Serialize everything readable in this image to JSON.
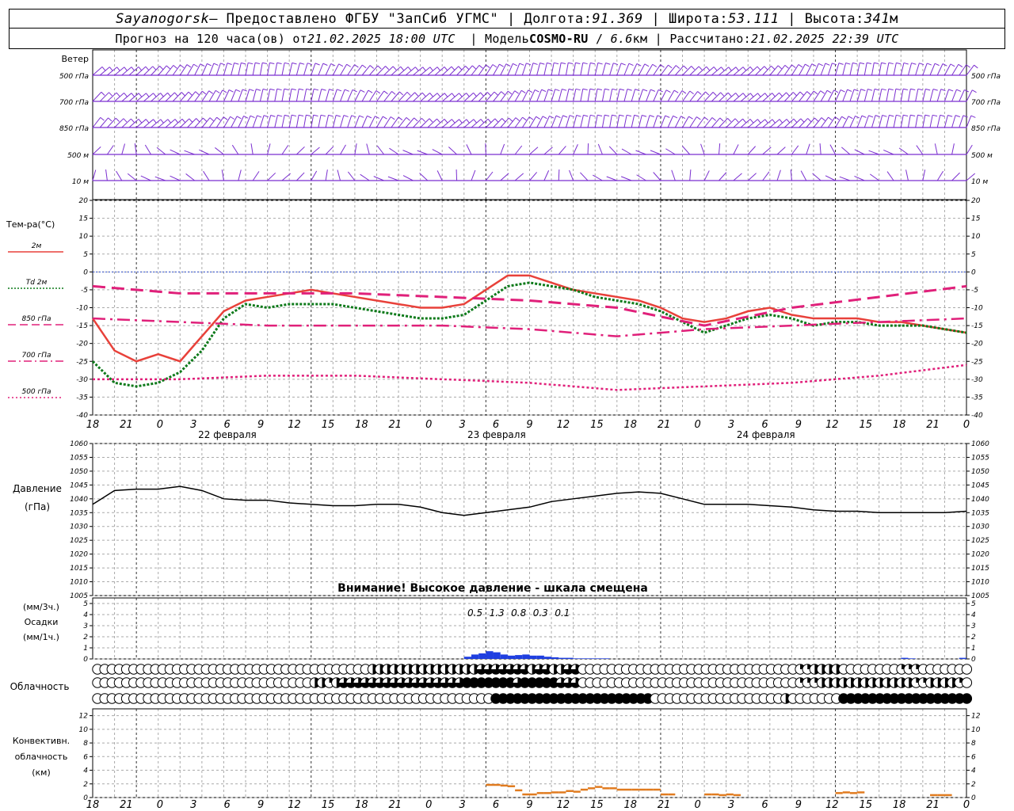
{
  "header": {
    "station": "Sayanogorsk",
    "provider": "— Предоставлено ФГБУ \"ЗапСиб УГМС\"",
    "lon_label": "Долгота:",
    "lon": "91.369",
    "lat_label": "Широта:",
    "lat": "53.111",
    "alt_label": "Высота:",
    "alt": "341",
    "alt_unit": "м",
    "forecast_label": "Прогноз на 120 часа(ов) от",
    "forecast_time": "21.02.2025 18:00 UTC",
    "model_label": "Модель",
    "model": "COSMO-RU",
    "model_res": "6.6",
    "model_res_unit": "км",
    "calc_label": "Рассчитано:",
    "calc_time": "21.02.2025 22:39 UTC"
  },
  "wind_panel": {
    "title": "Ветер",
    "levels": [
      "500 гПа",
      "700 гПа",
      "850 гПа",
      "500 м",
      "10 м"
    ],
    "color": "#7b2fd0"
  },
  "x_axis": {
    "ticks": [
      "18",
      "21",
      "0",
      "3",
      "6",
      "9",
      "12",
      "15",
      "18",
      "21",
      "0",
      "3",
      "6",
      "9",
      "12",
      "15",
      "18",
      "21",
      "0",
      "3",
      "6",
      "9",
      "12",
      "15",
      "18",
      "21",
      "0"
    ],
    "days": [
      "22 февраля",
      "23 февраля",
      "24 февраля"
    ]
  },
  "temp_panel": {
    "title": "Тем-ра(°C)",
    "y_ticks": [
      "20",
      "15",
      "10",
      "5",
      "0",
      "-5",
      "-10",
      "-15",
      "-20",
      "-25",
      "-30",
      "-35",
      "-40"
    ],
    "legend": [
      {
        "label": "2м",
        "color": "#e8413a",
        "style": "solid"
      },
      {
        "label": "Td  2м",
        "color": "#0d7a1a",
        "style": "dotted"
      },
      {
        "label": "850 гПа",
        "color": "#e0207a",
        "style": "dash"
      },
      {
        "label": "700 гПа",
        "color": "#e0207a",
        "style": "dashdot"
      },
      {
        "label": "500 гПа",
        "color": "#e0207a",
        "style": "dot"
      }
    ]
  },
  "pressure_panel": {
    "title": "Давление",
    "unit": "(гПа)",
    "y_ticks": [
      "1060",
      "1055",
      "1050",
      "1045",
      "1040",
      "1035",
      "1030",
      "1025",
      "1020",
      "1015",
      "1010",
      "1005"
    ],
    "warning": "Внимание! Высокое давление - шкала смещена"
  },
  "precip_panel": {
    "title1": "(мм/3ч.)",
    "title2": "Осадки",
    "title3": "(мм/1ч.)",
    "y_ticks": [
      "5",
      "4",
      "3",
      "2",
      "1",
      "0"
    ],
    "labels": [
      {
        "value": "0.5",
        "hour": 9
      },
      {
        "value": "1.3",
        "hour": 12
      },
      {
        "value": "0.8",
        "hour": 15
      },
      {
        "value": "0.3",
        "hour": 18
      },
      {
        "value": "0.1",
        "hour": 21
      }
    ]
  },
  "cloud_panel": {
    "title": "Облачность"
  },
  "conv_panel": {
    "title1": "Конвективн.",
    "title2": "облачность",
    "title3": "(км)",
    "y_ticks": [
      "12",
      "10",
      "8",
      "6",
      "4",
      "2",
      "0"
    ]
  },
  "chart_data": [
    {
      "type": "line",
      "title": "Тем-ра(°C)",
      "x_unit": "hours from 21.02.2025 18:00 UTC",
      "ylim": [
        -40,
        20
      ],
      "series": [
        {
          "name": "2м",
          "x": [
            0,
            3,
            6,
            9,
            12,
            15,
            18,
            21,
            24,
            27,
            30,
            33,
            36,
            39,
            42,
            45,
            48,
            51,
            54,
            57,
            60,
            63,
            66,
            69,
            72,
            75,
            78,
            81,
            84,
            87,
            90,
            93,
            96,
            99,
            102,
            105,
            108,
            111,
            114,
            117,
            120
          ],
          "values": [
            -13,
            -22,
            -25,
            -23,
            -25,
            -18,
            -11,
            -8,
            -7,
            -6,
            -5,
            -6,
            -7,
            -8,
            -9,
            -10,
            -10,
            -9,
            -5,
            -1,
            -1,
            -3,
            -5,
            -6,
            -7,
            -8,
            -10,
            -13,
            -14,
            -13,
            -11,
            -10,
            -12,
            -13,
            -13,
            -13,
            -14,
            -14,
            -15,
            -16,
            -17
          ],
          "color": "#e8413a"
        },
        {
          "name": "Td 2м",
          "x": [
            0,
            3,
            6,
            9,
            12,
            15,
            18,
            21,
            24,
            27,
            30,
            33,
            36,
            39,
            42,
            45,
            48,
            51,
            54,
            57,
            60,
            63,
            66,
            69,
            72,
            75,
            78,
            81,
            84,
            87,
            90,
            93,
            96,
            99,
            102,
            105,
            108,
            111,
            114,
            117,
            120
          ],
          "values": [
            -25,
            -31,
            -32,
            -31,
            -28,
            -22,
            -13,
            -9,
            -10,
            -9,
            -9,
            -9,
            -10,
            -11,
            -12,
            -13,
            -13,
            -12,
            -8,
            -4,
            -3,
            -4,
            -5,
            -7,
            -8,
            -9,
            -11,
            -14,
            -17,
            -15,
            -13,
            -12,
            -13,
            -15,
            -14,
            -14,
            -15,
            -15,
            -15,
            -16,
            -17
          ],
          "color": "#0d7a1a"
        },
        {
          "name": "850 гПа",
          "x": [
            0,
            12,
            24,
            36,
            48,
            60,
            72,
            84,
            96,
            108,
            120
          ],
          "values": [
            -4,
            -6,
            -6,
            -6,
            -7,
            -8,
            -10,
            -15,
            -10,
            -7,
            -4
          ],
          "color": "#e0207a"
        },
        {
          "name": "700 гПа",
          "x": [
            0,
            12,
            24,
            36,
            48,
            60,
            72,
            84,
            96,
            108,
            120
          ],
          "values": [
            -13,
            -14,
            -15,
            -15,
            -15,
            -16,
            -18,
            -16,
            -15,
            -14,
            -13
          ],
          "color": "#e0207a"
        },
        {
          "name": "500 гПа",
          "x": [
            0,
            12,
            24,
            36,
            48,
            60,
            72,
            84,
            96,
            108,
            120
          ],
          "values": [
            -30,
            -30,
            -29,
            -29,
            -30,
            -31,
            -33,
            -32,
            -31,
            -29,
            -26
          ],
          "color": "#e0207a"
        }
      ]
    },
    {
      "type": "line",
      "title": "Давление",
      "x_unit": "hours from 21.02.2025 18:00 UTC",
      "ylim": [
        1005,
        1060
      ],
      "series": [
        {
          "name": "",
          "x": [
            0,
            3,
            6,
            9,
            12,
            15,
            18,
            21,
            24,
            27,
            30,
            33,
            36,
            39,
            42,
            45,
            48,
            51,
            54,
            57,
            60,
            63,
            66,
            69,
            72,
            75,
            78,
            81,
            84,
            87,
            90,
            93,
            96,
            99,
            102,
            105,
            108,
            111,
            114,
            117,
            120
          ],
          "values": [
            1038,
            1043,
            1043.5,
            1043.5,
            1044.5,
            1043,
            1040,
            1039.5,
            1039.5,
            1038.5,
            1038,
            1037.5,
            1037.5,
            1038,
            1038,
            1037,
            1035,
            1034,
            1035,
            1036,
            1037,
            1039,
            1040,
            1041,
            1042,
            1042.5,
            1042,
            1040,
            1038,
            1038,
            1038,
            1037.5,
            1037,
            1036,
            1035.5,
            1035.5,
            1035,
            1035,
            1035,
            1035,
            1035.5
          ],
          "color": "#000000"
        }
      ]
    },
    {
      "type": "bar",
      "title": "Осадки",
      "x_unit": "hours from 21.02.2025 18:00 UTC",
      "ylim": [
        0,
        5
      ],
      "x": [
        51,
        52,
        53,
        54,
        55,
        56,
        57,
        58,
        59,
        60,
        61,
        62,
        63,
        64,
        65,
        66,
        67,
        68,
        69,
        70,
        111,
        112,
        119
      ],
      "values": [
        0.2,
        0.4,
        0.5,
        0.7,
        0.6,
        0.4,
        0.3,
        0.35,
        0.4,
        0.3,
        0.3,
        0.2,
        0.15,
        0.1,
        0.1,
        0.05,
        0.05,
        0.05,
        0.05,
        0.05,
        0.1,
        0.05,
        0.1
      ],
      "color": "#1f3fe0"
    },
    {
      "type": "table",
      "title": "Облачность",
      "rows": [
        {
          "name": "upper",
          "fractions": [
            0,
            0,
            0,
            0,
            0,
            0,
            0,
            0,
            0,
            0,
            0,
            0,
            0,
            0,
            0,
            0,
            0,
            0,
            0,
            0,
            0,
            0,
            0,
            0,
            0,
            0,
            0,
            0,
            0,
            0,
            0,
            0,
            0,
            0,
            0,
            0,
            0,
            0,
            0.5,
            0.5,
            0.5,
            0.5,
            0.5,
            0.5,
            0.5,
            0.5,
            0.5,
            0.5,
            0.5,
            0.5,
            0.5,
            0.5,
            0.5,
            0.75,
            0.75,
            0.75,
            0.75,
            0.75,
            0.75,
            0.75,
            0.5,
            0.75,
            0.75,
            0.5,
            0.5,
            0.75,
            0.75,
            0,
            0,
            0,
            0,
            0,
            0,
            0,
            0,
            0,
            0,
            0,
            0,
            0,
            0,
            0,
            0,
            0,
            0,
            0,
            0,
            0,
            0,
            0,
            0,
            0,
            0,
            0,
            0,
            0,
            0,
            0.25,
            0.25,
            0.5,
            0.5,
            0.5,
            0.5,
            0,
            0,
            0,
            0,
            0,
            0,
            0,
            0,
            0.25,
            0.25,
            0.25,
            0,
            0,
            0,
            0,
            0,
            0,
            0,
            0,
            0
          ]
        },
        {
          "name": "middle",
          "fractions": [
            0,
            0,
            0,
            0,
            0,
            0,
            0,
            0,
            0,
            0,
            0,
            0,
            0,
            0,
            0,
            0,
            0,
            0,
            0,
            0,
            0,
            0,
            0,
            0,
            0,
            0,
            0,
            0,
            0,
            0,
            0.5,
            0.5,
            0.25,
            0.5,
            0.75,
            0.75,
            0.75,
            0.75,
            0.75,
            0.75,
            0.75,
            0.75,
            0.75,
            0.75,
            0.75,
            0.75,
            0.75,
            0.75,
            0.75,
            0.75,
            0.75,
            1,
            1,
            1,
            1,
            1,
            1,
            1,
            0.75,
            1,
            1,
            1,
            1,
            1,
            0.75,
            0.75,
            0.75,
            0,
            0,
            0,
            0,
            0,
            0,
            0,
            0,
            0,
            0,
            0,
            0,
            0,
            0,
            0,
            0,
            0,
            0,
            0,
            0,
            0,
            0,
            0,
            0,
            0,
            0,
            0,
            0,
            0,
            0,
            0.25,
            0.25,
            0.25,
            0.5,
            0.5,
            0.5,
            0.5,
            0.5,
            0.5,
            0.5,
            0.5,
            0.5,
            0.5,
            0.5,
            0.5,
            0.5,
            0.25,
            0.25,
            0.5,
            0.5,
            0.5,
            0.5,
            0.25,
            0
          ]
        },
        {
          "name": "lower",
          "fractions": [
            0,
            0,
            0,
            0,
            0,
            0,
            0,
            0,
            0,
            0,
            0,
            0,
            0,
            0,
            0,
            0,
            0,
            0,
            0,
            0,
            0,
            0,
            0,
            0,
            0,
            0,
            0,
            0,
            0,
            0,
            0,
            0,
            0,
            0,
            0,
            0,
            0,
            0,
            0,
            0,
            0,
            0,
            0,
            0,
            0,
            0,
            0,
            0,
            0,
            0,
            0,
            0,
            0,
            0,
            0,
            1,
            1,
            1,
            1,
            1,
            1,
            1,
            1,
            1,
            1,
            1,
            1,
            1,
            1,
            1,
            1,
            1,
            1,
            1,
            1,
            1,
            1,
            0,
            0,
            0,
            0,
            0,
            0,
            0,
            0,
            0,
            0,
            0,
            0,
            0,
            0,
            0,
            0,
            0,
            0,
            0.5,
            0,
            0,
            0,
            0,
            0,
            0,
            0,
            1,
            1,
            1,
            1,
            1,
            1,
            1,
            1,
            1,
            1,
            1,
            1,
            1,
            1,
            1,
            1,
            1,
            1,
            1,
            1,
            1
          ]
        }
      ]
    },
    {
      "type": "bar",
      "title": "Конвективн. облачность (км)",
      "x_unit": "hours from 21.02.2025 18:00 UTC",
      "ylim": [
        0,
        13
      ],
      "x": [
        54,
        55,
        56,
        57,
        58,
        59,
        60,
        61,
        62,
        63,
        64,
        65,
        66,
        67,
        68,
        69,
        70,
        71,
        72,
        73,
        74,
        75,
        76,
        77,
        78,
        79,
        84,
        85,
        86,
        87,
        88,
        102,
        103,
        104,
        105,
        115,
        116,
        117
      ],
      "values": [
        2,
        2,
        1.9,
        1.8,
        1.2,
        0.6,
        0.6,
        0.8,
        0.8,
        0.9,
        0.9,
        1.1,
        1.0,
        1.3,
        1.5,
        1.7,
        1.5,
        1.5,
        1.3,
        1.3,
        1.3,
        1.3,
        1.3,
        1.3,
        0.6,
        0.6,
        0.6,
        0.6,
        0.5,
        0.6,
        0.5,
        0.8,
        0.9,
        0.8,
        0.9,
        0.5,
        0.5,
        0.5
      ],
      "color": "#e07b1f"
    }
  ]
}
